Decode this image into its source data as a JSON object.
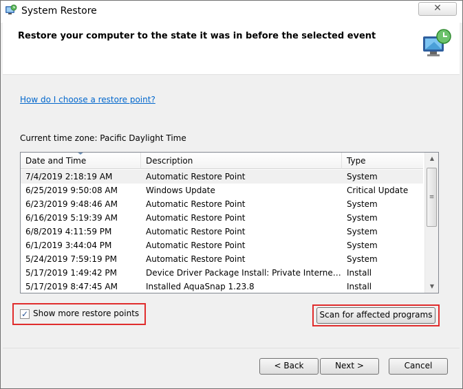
{
  "window": {
    "title": "System Restore",
    "close_glyph": "✕"
  },
  "header": {
    "title": "Restore your computer to the state it was in before the selected event"
  },
  "help_link": "How do I choose a restore point?",
  "timezone_label": "Current time zone: Pacific Daylight Time",
  "table": {
    "columns": [
      "Date and Time",
      "Description",
      "Type"
    ],
    "rows": [
      [
        "7/4/2019 2:18:19 AM",
        "Automatic Restore Point",
        "System"
      ],
      [
        "6/25/2019 9:50:08 AM",
        "Windows Update",
        "Critical Update"
      ],
      [
        "6/23/2019 9:48:46 AM",
        "Automatic Restore Point",
        "System"
      ],
      [
        "6/16/2019 5:19:39 AM",
        "Automatic Restore Point",
        "System"
      ],
      [
        "6/8/2019 4:11:59 PM",
        "Automatic Restore Point",
        "System"
      ],
      [
        "6/1/2019 3:44:04 PM",
        "Automatic Restore Point",
        "System"
      ],
      [
        "5/24/2019 7:59:19 PM",
        "Automatic Restore Point",
        "System"
      ],
      [
        "5/17/2019 1:49:42 PM",
        "Device Driver Package Install: Private Internet ...",
        "Install"
      ],
      [
        "5/17/2019 8:47:45 AM",
        "Installed AquaSnap 1.23.8",
        "Install"
      ]
    ]
  },
  "show_more": {
    "label": "Show more restore points",
    "checked": true
  },
  "buttons": {
    "scan": "Scan for affected programs",
    "back": "< Back",
    "next": "Next >",
    "cancel": "Cancel"
  },
  "colors": {
    "link": "#0066cc",
    "highlight": "#e02b2b"
  }
}
